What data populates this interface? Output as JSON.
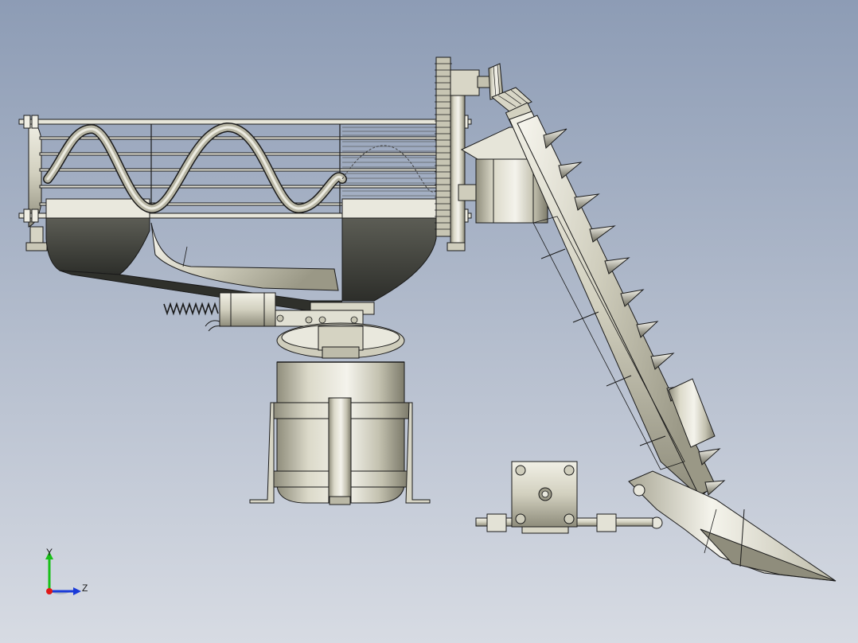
{
  "colors": {
    "bg_top": "#8d9cb5",
    "bg_bottom": "#d7dbe3",
    "metal_light": "#e6e4d8",
    "metal_mid": "#bdbba8",
    "metal_dark": "#5a5a50",
    "edge": "#1a1a1a",
    "hopper_dark": "#3c3d38",
    "axis_y": "#18c018",
    "axis_z": "#1a3ad8",
    "axis_x": "#e01818"
  },
  "triad": {
    "y_label": "Y",
    "z_label": "Z"
  },
  "parts": [
    "auger-cage",
    "helical-auger",
    "feed-hopper",
    "drive-gear",
    "bevel-gear-pair",
    "stepper-motor-top",
    "inclined-conveyor",
    "conveyor-teeth",
    "conveyor-motor-housing",
    "scoop-shovel",
    "stepper-motor-bottom",
    "guide-rod",
    "spring-actuator",
    "rotary-plate",
    "cylindrical-tank",
    "tank-mount-frame"
  ]
}
